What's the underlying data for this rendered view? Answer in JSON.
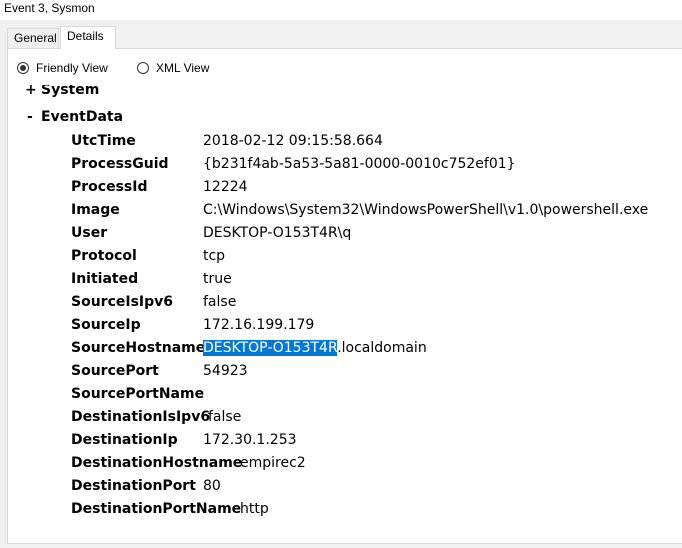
{
  "window": {
    "title": "Event 3, Sysmon"
  },
  "tabs": [
    {
      "label": "General"
    },
    {
      "label": "Details"
    }
  ],
  "view_options": {
    "friendly_label": "Friendly View",
    "xml_label": "XML View"
  },
  "tree": {
    "system": {
      "sign": "+",
      "label": "System"
    },
    "eventdata": {
      "sign": "-",
      "label": "EventData"
    }
  },
  "fields": [
    {
      "key": "UtcTime",
      "value": "2018-02-12 09:15:58.664"
    },
    {
      "key": "ProcessGuid",
      "value": "{b231f4ab-5a53-5a81-0000-0010c752ef01}"
    },
    {
      "key": "ProcessId",
      "value": "12224"
    },
    {
      "key": "Image",
      "value": "C:\\Windows\\System32\\WindowsPowerShell\\v1.0\\powershell.exe"
    },
    {
      "key": "User",
      "value": "DESKTOP-O153T4R\\q"
    },
    {
      "key": "Protocol",
      "value": "tcp"
    },
    {
      "key": "Initiated",
      "value": "true"
    },
    {
      "key": "SourceIsIpv6",
      "value": "false"
    },
    {
      "key": "SourceIp",
      "value": "172.16.199.179"
    },
    {
      "key": "SourceHostname",
      "value_selected": "DESKTOP-O153T4R",
      "value_rest": ".localdomain"
    },
    {
      "key": "SourcePort",
      "value": "54923"
    },
    {
      "key": "SourcePortName",
      "value": ""
    },
    {
      "key": "DestinationIsIpv6",
      "value": "false"
    },
    {
      "key": "DestinationIp",
      "value": "172.30.1.253"
    },
    {
      "key": "DestinationHostname",
      "value": "empirec2"
    },
    {
      "key": "DestinationPort",
      "value": "80"
    },
    {
      "key": "DestinationPortName",
      "value": "http"
    }
  ],
  "colors": {
    "selection": "#0078d7",
    "window_bg": "#f0f0f0",
    "panel_bg": "#ffffff"
  }
}
